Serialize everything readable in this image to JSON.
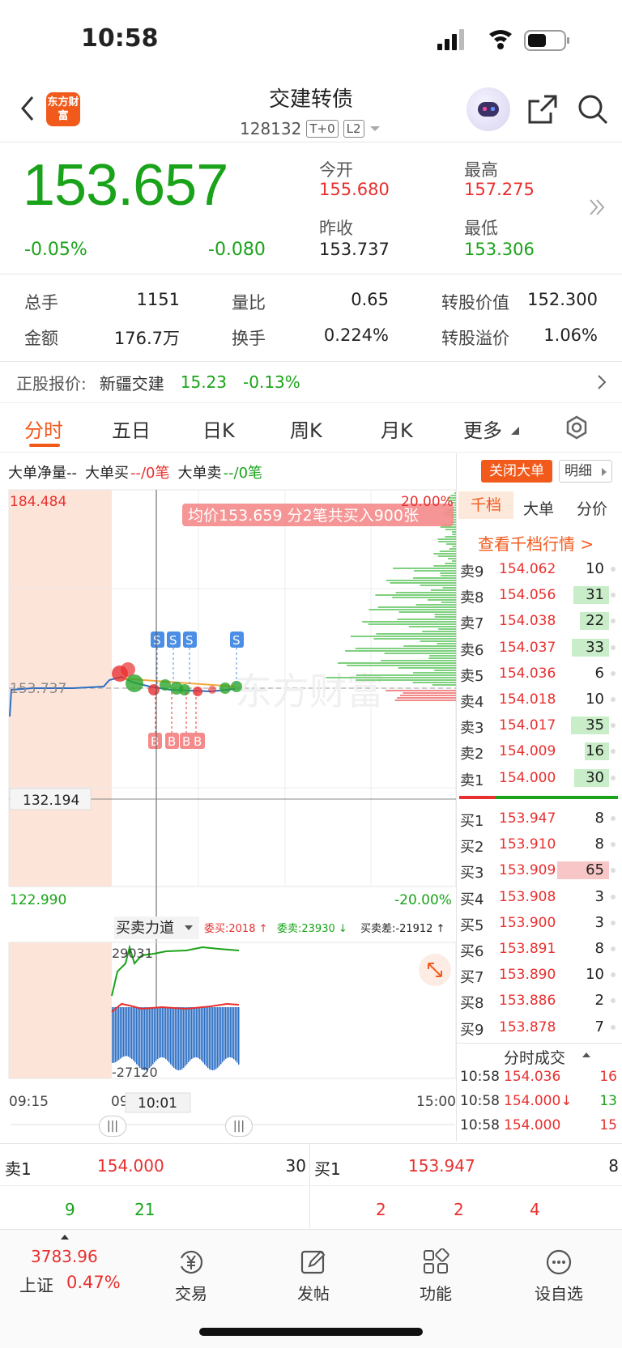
{
  "status": {
    "time": "10:58"
  },
  "header": {
    "title": "交建转债",
    "code": "128132",
    "tag1": "T+0",
    "tag2": "L2",
    "logo": "东方财富"
  },
  "quote": {
    "price": "153.657",
    "pct": "-0.05%",
    "chg": "-0.080",
    "open_label": "今开",
    "open": "155.680",
    "high_label": "最高",
    "high": "157.275",
    "prev_label": "昨收",
    "prev": "153.737",
    "low_label": "最低",
    "low": "153.306"
  },
  "stats": {
    "vol_label": "总手",
    "vol": "1151",
    "ratio_label": "量比",
    "ratio": "0.65",
    "conv_label": "转股价值",
    "conv": "152.300",
    "amt_label": "金额",
    "amt": "176.7万",
    "turn_label": "换手",
    "turn": "0.224%",
    "prem_label": "转股溢价",
    "prem": "1.06%"
  },
  "underlying": {
    "label": "正股报价:",
    "name": "新疆交建",
    "price": "15.23",
    "pct": "-0.13%"
  },
  "tabs": [
    "分时",
    "五日",
    "日K",
    "周K",
    "月K",
    "更多"
  ],
  "bigorder": {
    "net": "大单净量--",
    "buy_label": "大单买",
    "buy_val": "--/0笔",
    "sell_label": "大单卖",
    "sell_val": "--/0笔",
    "close_btn": "关闭大单",
    "detail_btn": "明细"
  },
  "chart": {
    "ymax": "184.484",
    "ymid": "153.737",
    "ymin": "122.990",
    "ycursor": "132.194",
    "pct_top": "20.00%",
    "pct_bot": "-20.00%",
    "avg_banner": "均价153.659  分2笔共买入900张",
    "t_start": "09:15",
    "t_cursor": "10:01",
    "t_end": "15:00",
    "t_partial": "09",
    "power_label": "买卖力道",
    "wei_buy": "委买:2018 ↑",
    "wei_sell": "委卖:23930 ↓",
    "wei_diff": "买卖差:-21912 ↑",
    "p_top": "29031",
    "p_bot": "-27120",
    "s_marker": "S",
    "b_marker": "B"
  },
  "book_tabs": [
    "千档",
    "大单",
    "分价"
  ],
  "book_link": "查看千档行情 >",
  "asks": [
    {
      "label": "卖9",
      "price": "154.062",
      "vol": "10"
    },
    {
      "label": "卖8",
      "price": "154.056",
      "vol": "31"
    },
    {
      "label": "卖7",
      "price": "154.038",
      "vol": "22"
    },
    {
      "label": "卖6",
      "price": "154.037",
      "vol": "33"
    },
    {
      "label": "卖5",
      "price": "154.036",
      "vol": "6"
    },
    {
      "label": "卖4",
      "price": "154.018",
      "vol": "10"
    },
    {
      "label": "卖3",
      "price": "154.017",
      "vol": "35"
    },
    {
      "label": "卖2",
      "price": "154.009",
      "vol": "16"
    },
    {
      "label": "卖1",
      "price": "154.000",
      "vol": "30"
    }
  ],
  "bids": [
    {
      "label": "买1",
      "price": "153.947",
      "vol": "8"
    },
    {
      "label": "买2",
      "price": "153.910",
      "vol": "8"
    },
    {
      "label": "买3",
      "price": "153.909",
      "vol": "65"
    },
    {
      "label": "买4",
      "price": "153.908",
      "vol": "3"
    },
    {
      "label": "买5",
      "price": "153.900",
      "vol": "3"
    },
    {
      "label": "买6",
      "price": "153.891",
      "vol": "8"
    },
    {
      "label": "买7",
      "price": "153.890",
      "vol": "10"
    },
    {
      "label": "买8",
      "price": "153.886",
      "vol": "2"
    },
    {
      "label": "买9",
      "price": "153.878",
      "vol": "7"
    }
  ],
  "trades_title": "分时成交",
  "trades": [
    {
      "time": "10:58",
      "price": "154.036",
      "vol": "16"
    },
    {
      "time": "10:58",
      "price": "154.000↓",
      "vol": "13"
    },
    {
      "time": "10:58",
      "price": "154.000",
      "vol": "15"
    }
  ],
  "summary": {
    "sell_label": "卖1",
    "sell_price": "154.000",
    "sell_vol": "30",
    "buy_label": "买1",
    "buy_price": "153.947",
    "buy_vol": "8",
    "left_a": "9",
    "left_b": "21",
    "right_a": "2",
    "right_b": "2",
    "right_c": "4"
  },
  "nav": {
    "index_val": "3783.96",
    "index_name": "上证",
    "index_pct": "0.47%",
    "trade": "交易",
    "post": "发帖",
    "func": "功能",
    "watch": "设自选"
  }
}
